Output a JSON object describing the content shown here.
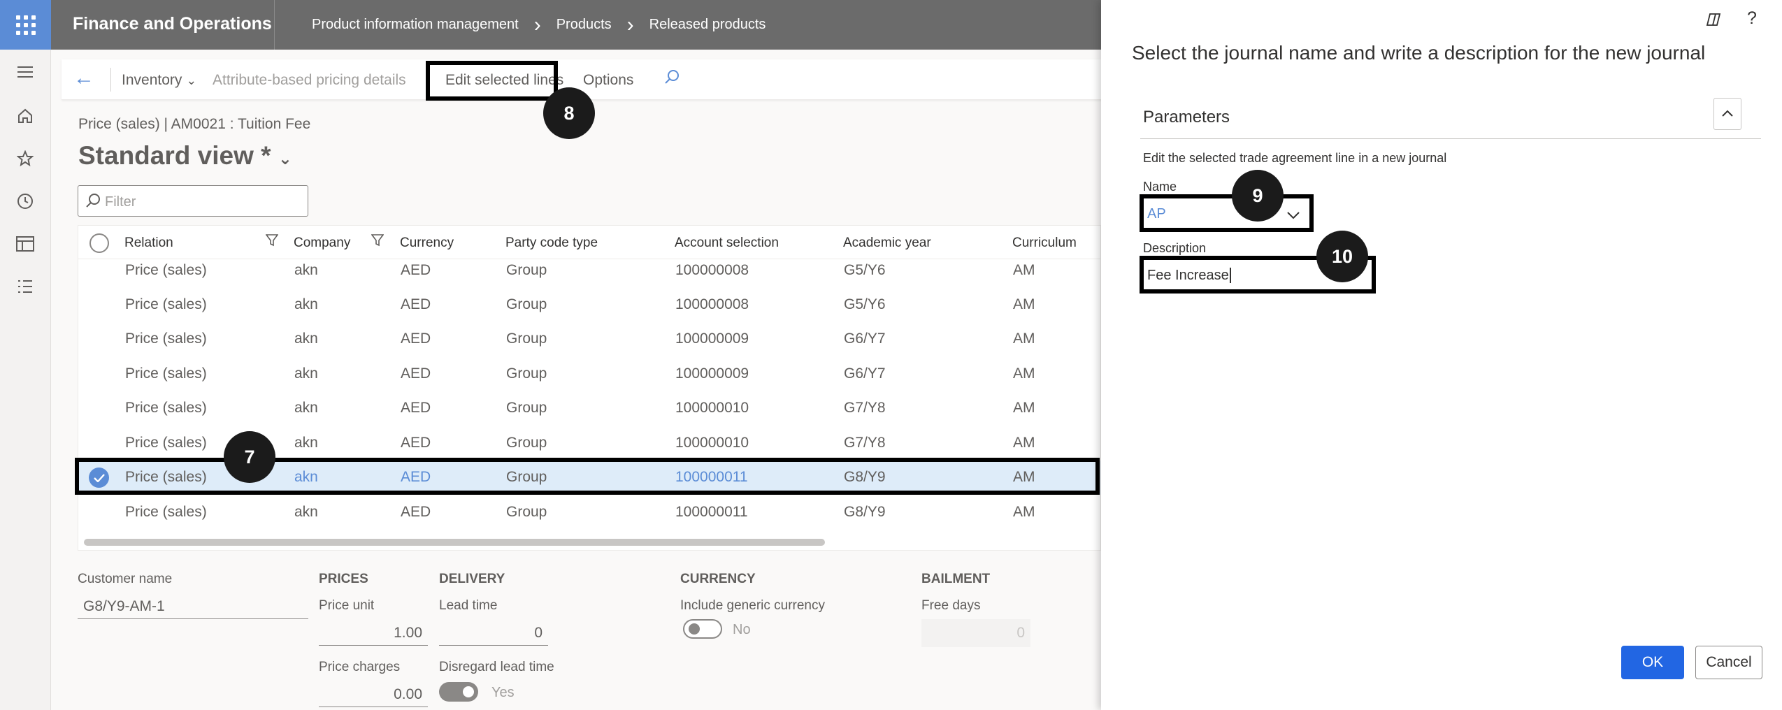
{
  "app": {
    "title": "Finance and Operations"
  },
  "breadcrumb": [
    "Product information management",
    "Products",
    "Released products"
  ],
  "actionpane": {
    "inventory": "Inventory",
    "attribute_pricing": "Attribute-based pricing details",
    "edit_selected": "Edit selected lines",
    "options": "Options"
  },
  "record": {
    "caption": "Price (sales)   |   AM0021 : Tuition Fee",
    "view": "Standard view *"
  },
  "filter": {
    "placeholder": "Filter"
  },
  "grid": {
    "headers": [
      "Relation",
      "Company",
      "Currency",
      "Party code type",
      "Account selection",
      "Academic year",
      "Curriculum"
    ],
    "rows": [
      [
        "Price (sales)",
        "akn",
        "AED",
        "Group",
        "100000008",
        "G5/Y6",
        "AM"
      ],
      [
        "Price (sales)",
        "akn",
        "AED",
        "Group",
        "100000008",
        "G5/Y6",
        "AM"
      ],
      [
        "Price (sales)",
        "akn",
        "AED",
        "Group",
        "100000009",
        "G6/Y7",
        "AM"
      ],
      [
        "Price (sales)",
        "akn",
        "AED",
        "Group",
        "100000009",
        "G6/Y7",
        "AM"
      ],
      [
        "Price (sales)",
        "akn",
        "AED",
        "Group",
        "100000010",
        "G7/Y8",
        "AM"
      ],
      [
        "Price (sales)",
        "akn",
        "AED",
        "Group",
        "100000010",
        "G7/Y8",
        "AM"
      ],
      [
        "Price (sales)",
        "akn",
        "AED",
        "Group",
        "100000011",
        "G8/Y9",
        "AM"
      ],
      [
        "Price (sales)",
        "akn",
        "AED",
        "Group",
        "100000011",
        "G8/Y9",
        "AM"
      ]
    ]
  },
  "details": {
    "customer_name_label": "Customer name",
    "customer_name": "G8/Y9-AM-1",
    "prices": "PRICES",
    "price_unit_label": "Price unit",
    "price_unit": "1.00",
    "price_charges_label": "Price charges",
    "price_charges": "0.00",
    "delivery": "DELIVERY",
    "lead_time_label": "Lead time",
    "lead_time": "0",
    "disregard_label": "Disregard lead time",
    "disregard_value": "Yes",
    "currency": "CURRENCY",
    "generic_label": "Include generic currency",
    "generic_value": "No",
    "bailment": "BAILMENT",
    "free_days_label": "Free days",
    "free_days": "0"
  },
  "panel": {
    "title": "Select the journal name and write a description for the new journal",
    "params": "Parameters",
    "desc": "Edit the selected trade agreement line in a new journal",
    "name_label": "Name",
    "name_value": "AP",
    "desc_label": "Description",
    "desc_value": "Fee Increase",
    "ok": "OK",
    "cancel": "Cancel",
    "help": "?"
  },
  "steps": [
    "7",
    "8",
    "9",
    "10"
  ]
}
